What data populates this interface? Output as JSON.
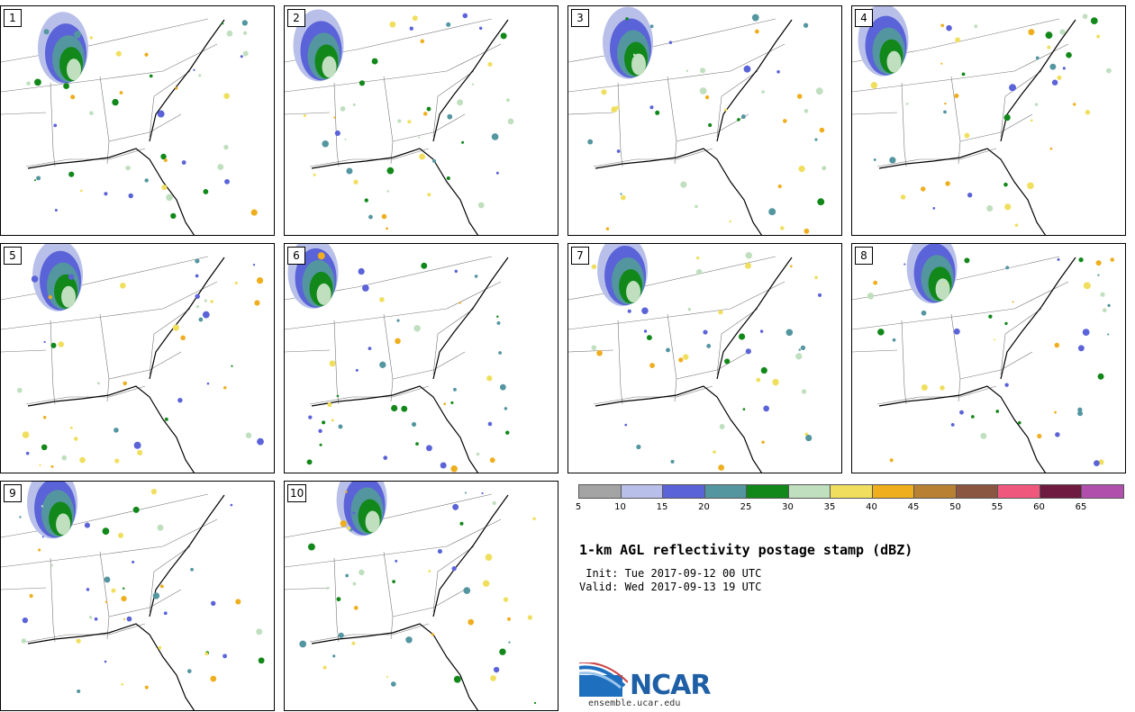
{
  "panels": [
    {
      "label": "1"
    },
    {
      "label": "2"
    },
    {
      "label": "3"
    },
    {
      "label": "4"
    },
    {
      "label": "5"
    },
    {
      "label": "6"
    },
    {
      "label": "7"
    },
    {
      "label": "8"
    },
    {
      "label": "9"
    },
    {
      "label": "10"
    }
  ],
  "colorbar": {
    "colors": [
      "#a4a4a4",
      "#b8c0ea",
      "#5b63d8",
      "#5496a0",
      "#12881a",
      "#bfdfbe",
      "#f0df5e",
      "#eeae1e",
      "#b88033",
      "#8a5641",
      "#f0577d",
      "#6f1a40",
      "#b14fac"
    ],
    "tick_labels": [
      "5",
      "10",
      "15",
      "20",
      "25",
      "30",
      "35",
      "40",
      "45",
      "50",
      "55",
      "60",
      "65"
    ]
  },
  "title": "1-km AGL reflectivity postage stamp (dBZ)",
  "init_line": " Init: Tue 2017-09-12 00 UTC",
  "valid_line": "Valid: Wed 2017-09-13 19 UTC",
  "logo": {
    "name": "NCAR",
    "url": "ensemble.ucar.edu"
  }
}
